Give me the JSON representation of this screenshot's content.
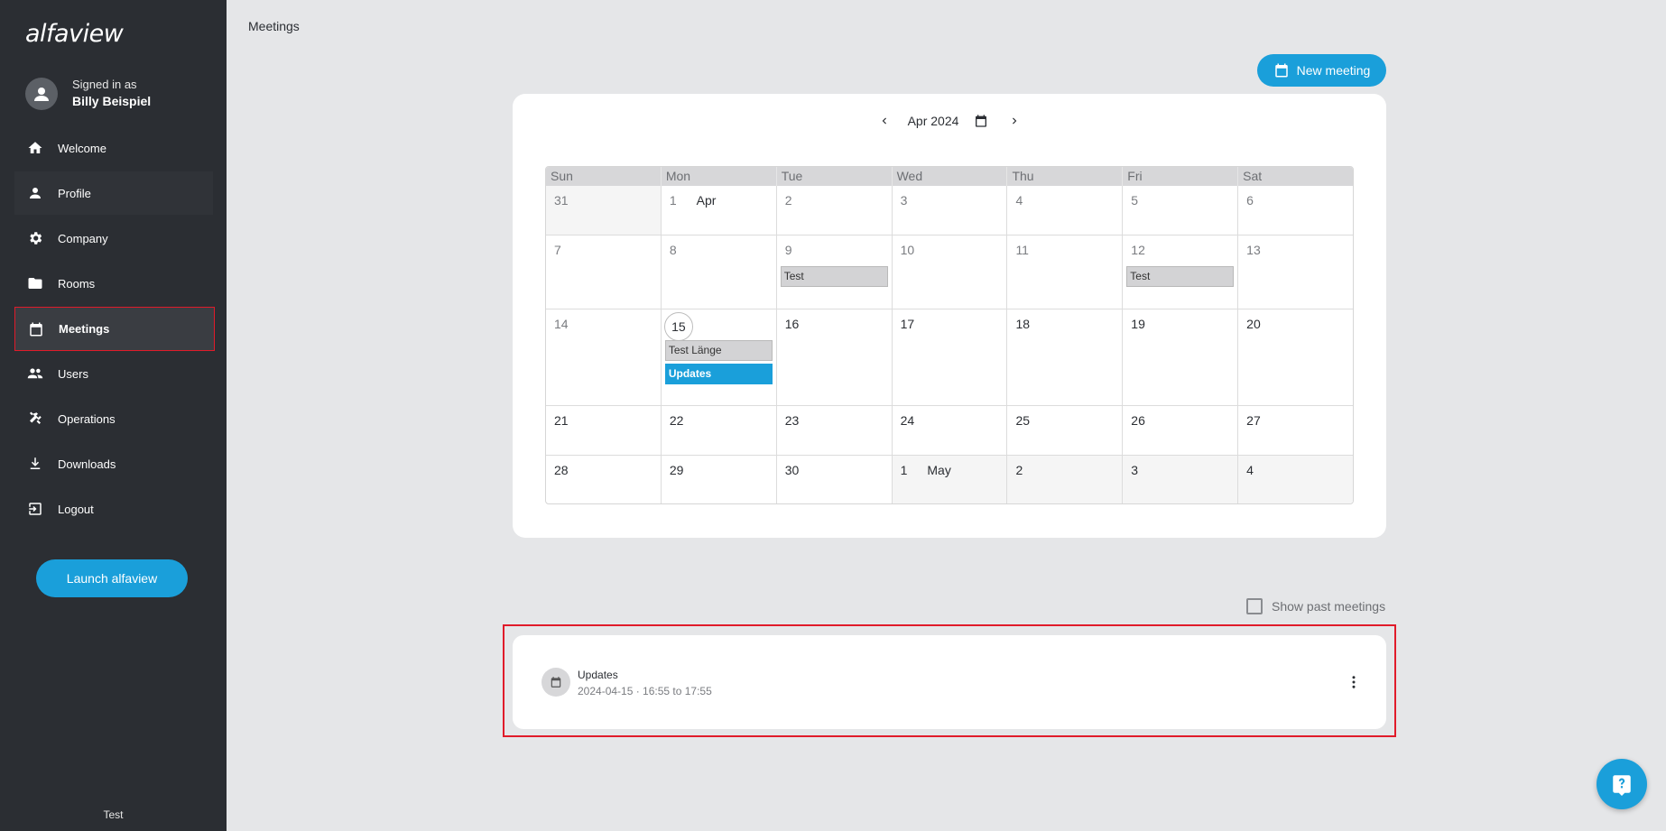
{
  "app": {
    "logo": "alfaview"
  },
  "user": {
    "signed_in_label": "Signed in as",
    "name": "Billy Beispiel"
  },
  "sidebar": {
    "items": [
      {
        "label": "Welcome",
        "icon": "home-icon"
      },
      {
        "label": "Profile",
        "icon": "person-icon"
      },
      {
        "label": "Company",
        "icon": "gear-icon"
      },
      {
        "label": "Rooms",
        "icon": "folder-icon"
      },
      {
        "label": "Meetings",
        "icon": "calendar-icon",
        "active": true
      },
      {
        "label": "Users",
        "icon": "users-icon"
      },
      {
        "label": "Operations",
        "icon": "tools-icon"
      },
      {
        "label": "Downloads",
        "icon": "download-icon"
      },
      {
        "label": "Logout",
        "icon": "logout-icon"
      }
    ],
    "launch_label": "Launch alfaview",
    "footer": "Test"
  },
  "header": {
    "title": "Meetings",
    "new_meeting_label": "New meeting"
  },
  "calendar": {
    "month_label": "Apr 2024",
    "weekdays": [
      "Sun",
      "Mon",
      "Tue",
      "Wed",
      "Thu",
      "Fri",
      "Sat"
    ],
    "weeks": [
      [
        "31",
        "1",
        "2",
        "3",
        "4",
        "5",
        "6"
      ],
      [
        "7",
        "8",
        "9",
        "10",
        "11",
        "12",
        "13"
      ],
      [
        "14",
        "15",
        "16",
        "17",
        "18",
        "19",
        "20"
      ],
      [
        "21",
        "22",
        "23",
        "24",
        "25",
        "26",
        "27"
      ],
      [
        "28",
        "29",
        "30",
        "1",
        "2",
        "3",
        "4"
      ]
    ],
    "month_marks": {
      "apr": "Apr",
      "may": "May"
    },
    "events": {
      "tue9": "Test",
      "fri12": "Test",
      "mon15_a": "Test Länge",
      "mon15_b": "Updates"
    }
  },
  "filters": {
    "show_past_label": "Show past meetings",
    "show_past_checked": false
  },
  "meetings": [
    {
      "title": "Updates",
      "time": "2024-04-15 · 16:55 to 17:55"
    }
  ],
  "colors": {
    "accent": "#1a9fda",
    "sidebar_bg": "#2b2e33",
    "highlight": "#e01b2a"
  }
}
